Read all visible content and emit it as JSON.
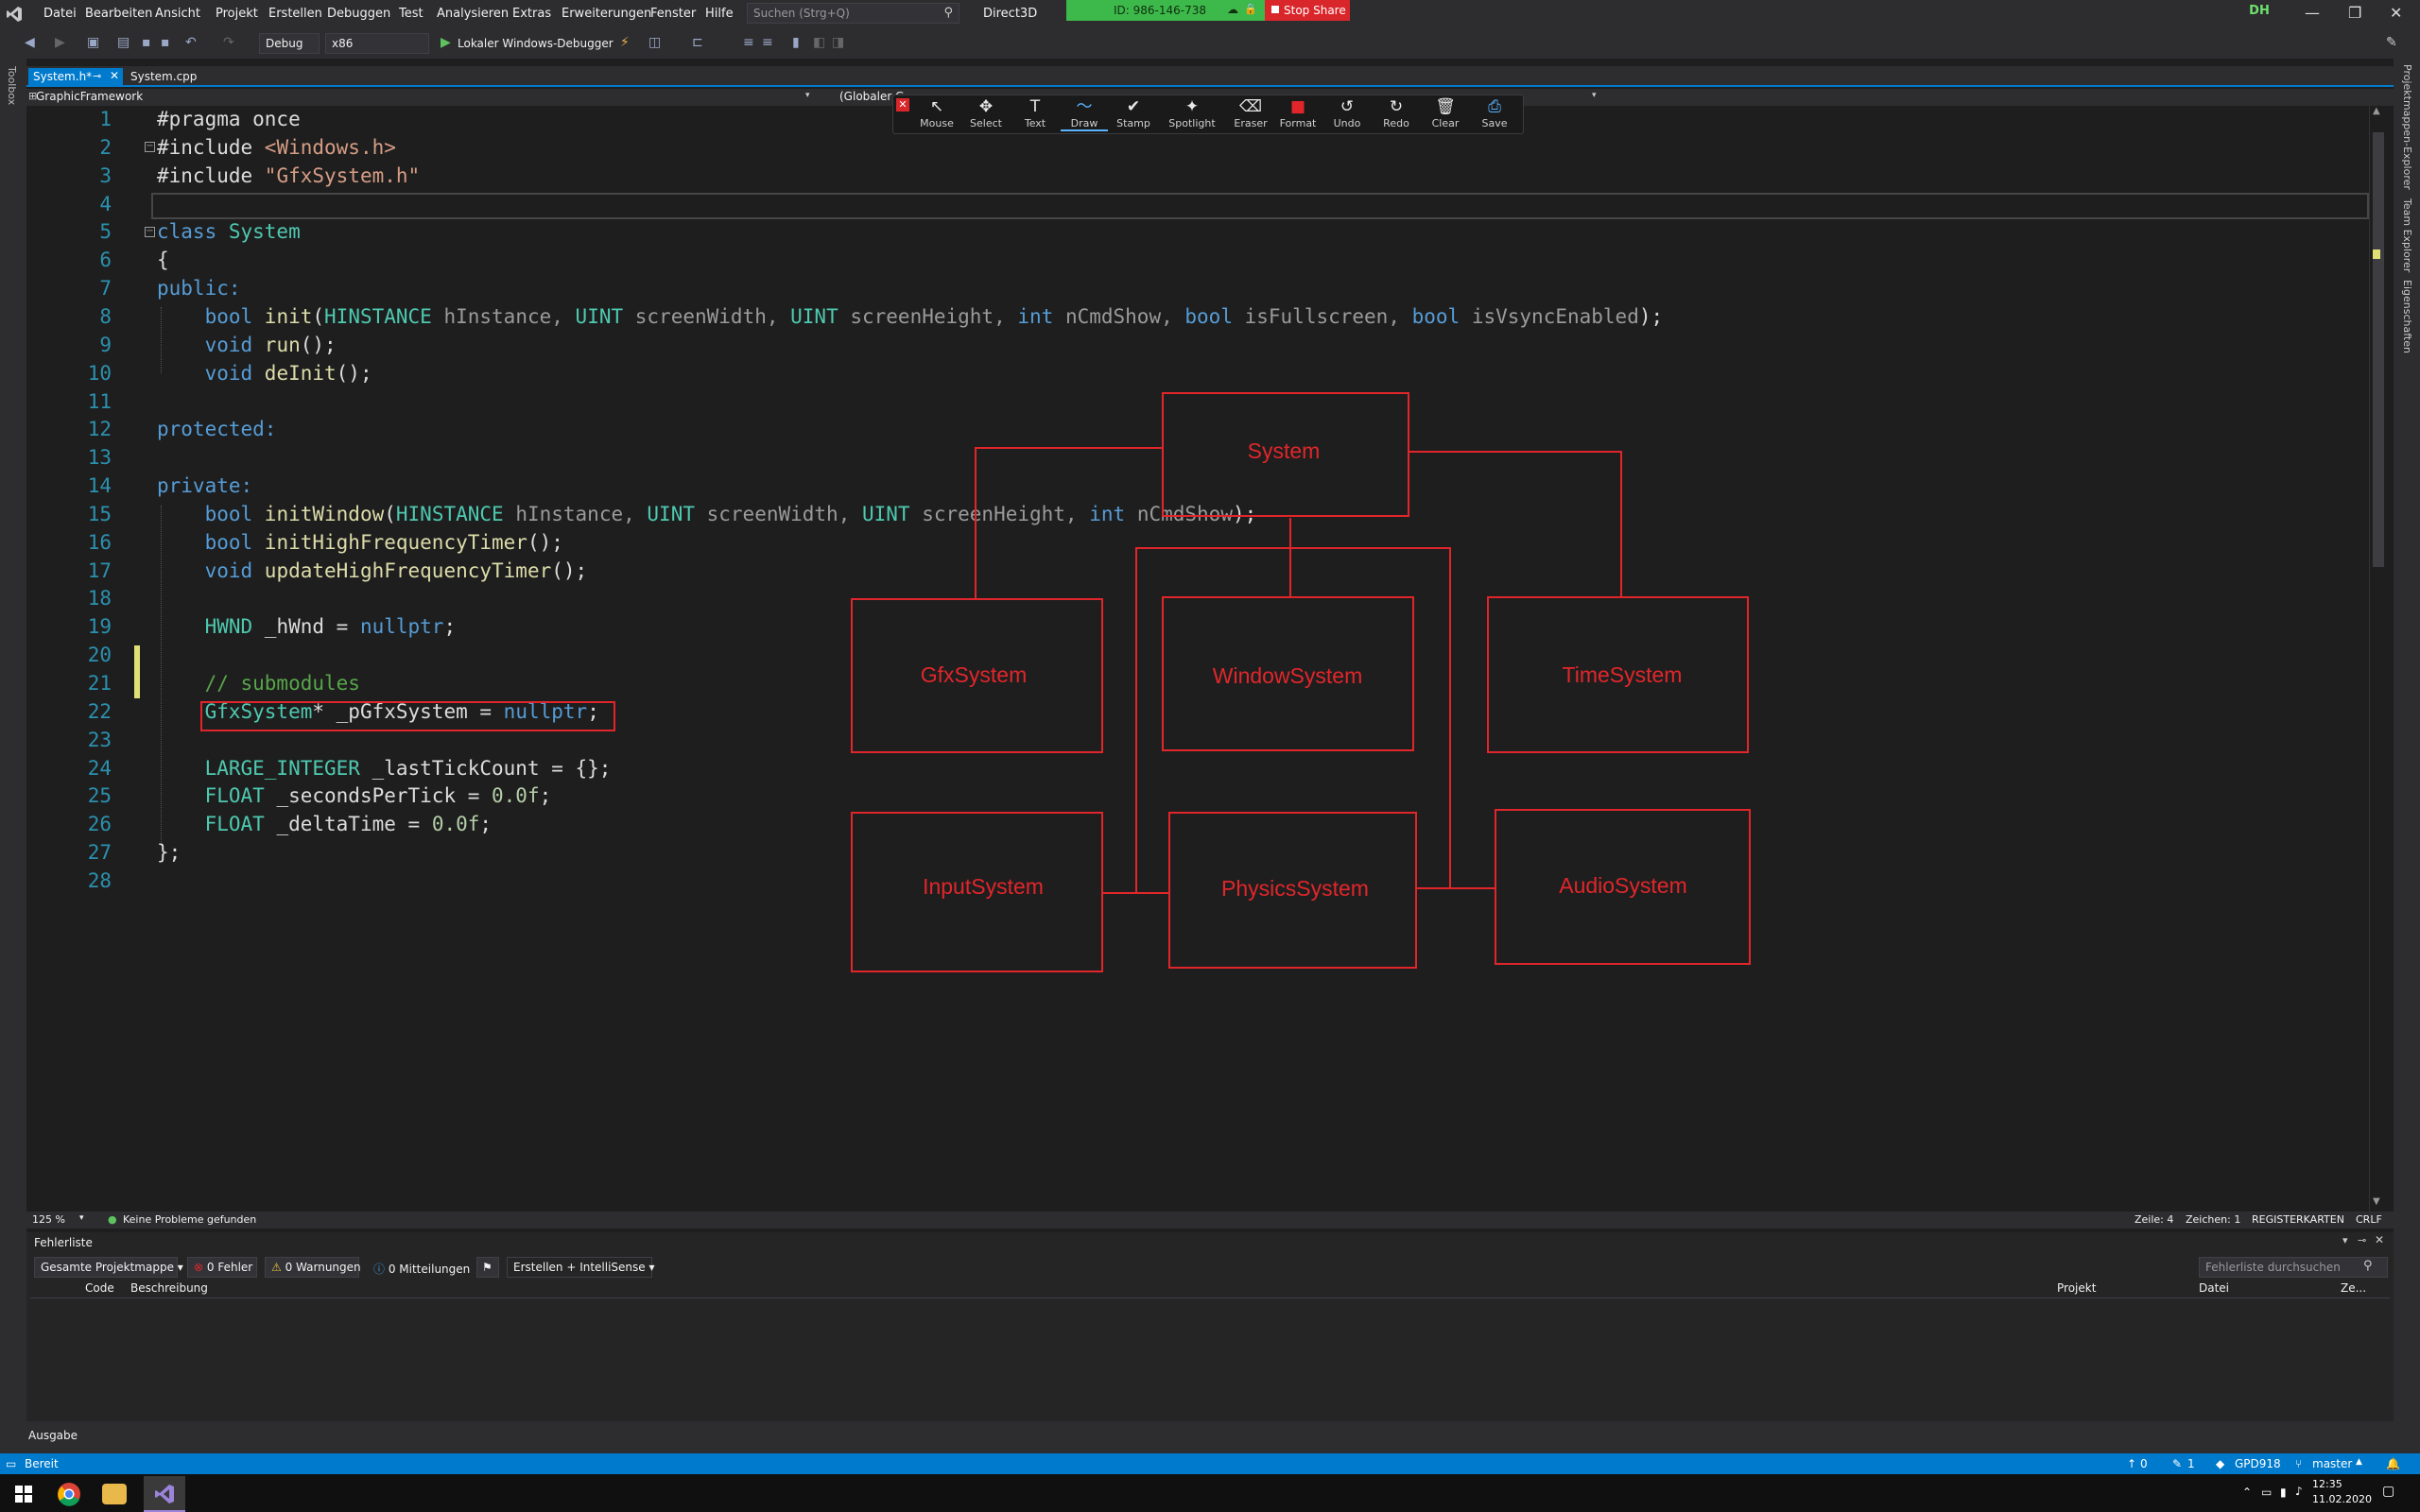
{
  "menu": [
    "Datei",
    "Bearbeiten",
    "Ansicht",
    "Projekt",
    "Erstellen",
    "Debuggen",
    "Test",
    "Analysieren",
    "Extras",
    "Erweiterungen",
    "Fenster",
    "Hilfe"
  ],
  "search_placeholder": "Suchen (Strg+Q)",
  "solution_name": "Direct3D",
  "share": {
    "id_label": "ID: 986-146-738",
    "stop_label": "Stop Share",
    "accent": "#3db84a",
    "stop_color": "#d9262b"
  },
  "user_initials": "DH",
  "toolbar": {
    "config": "Debug",
    "platform": "x86",
    "debugger": "Lokaler Windows-Debugger"
  },
  "left_strip_label": "Toolbox",
  "right_strip_labels": [
    "Projektmappen-Explorer",
    "Team Explorer",
    "Eigenschaften"
  ],
  "tabs": {
    "active": "System.h*",
    "inactive": "System.cpp"
  },
  "nav": {
    "project": "GraphicFramework",
    "scope": "(Globaler G"
  },
  "annotation_tools": [
    {
      "label": "Mouse",
      "icon": "cursor-icon",
      "glyph": "↖"
    },
    {
      "label": "Select",
      "icon": "move-icon",
      "glyph": "✥"
    },
    {
      "label": "Text",
      "icon": "text-icon",
      "glyph": "T"
    },
    {
      "label": "Draw",
      "icon": "draw-icon",
      "glyph": "〜"
    },
    {
      "label": "Stamp",
      "icon": "check-icon",
      "glyph": "✔"
    },
    {
      "label": "Spotlight",
      "icon": "spotlight-icon",
      "glyph": "✦"
    },
    {
      "label": "Eraser",
      "icon": "eraser-icon",
      "glyph": "⌫"
    },
    {
      "label": "Format",
      "icon": "format-icon",
      "glyph": "■"
    },
    {
      "label": "Undo",
      "icon": "undo-icon",
      "glyph": "↺"
    },
    {
      "label": "Redo",
      "icon": "redo-icon",
      "glyph": "↻"
    },
    {
      "label": "Clear",
      "icon": "trash-icon",
      "glyph": "🗑"
    },
    {
      "label": "Save",
      "icon": "save-icon",
      "glyph": "⎙"
    }
  ],
  "code_lines": [
    [
      {
        "t": "#pragma once",
        "c": "#dcdcdc"
      }
    ],
    [
      {
        "t": "#include ",
        "c": "#dcdcdc"
      },
      {
        "t": "<Windows.h>",
        "c": "#d69d85"
      }
    ],
    [
      {
        "t": "#include ",
        "c": "#dcdcdc"
      },
      {
        "t": "\"GfxSystem.h\"",
        "c": "#d69d85"
      }
    ],
    [],
    [
      {
        "t": "class ",
        "c": "#569cd6"
      },
      {
        "t": "System",
        "c": "#4ec9b0"
      }
    ],
    [
      {
        "t": "{",
        "c": "#dcdcdc"
      }
    ],
    [
      {
        "t": "public:",
        "c": "#569cd6"
      }
    ],
    [
      {
        "t": "    bool ",
        "c": "#569cd6"
      },
      {
        "t": "init",
        "c": "#dcdcaa"
      },
      {
        "t": "(",
        "c": "#dcdcdc"
      },
      {
        "t": "HINSTANCE ",
        "c": "#4ec9b0"
      },
      {
        "t": "hInstance, ",
        "c": "#9a9a9a"
      },
      {
        "t": "UINT ",
        "c": "#4ec9b0"
      },
      {
        "t": "screenWidth, ",
        "c": "#9a9a9a"
      },
      {
        "t": "UINT ",
        "c": "#4ec9b0"
      },
      {
        "t": "screenHeight, ",
        "c": "#9a9a9a"
      },
      {
        "t": "int ",
        "c": "#569cd6"
      },
      {
        "t": "nCmdShow, ",
        "c": "#9a9a9a"
      },
      {
        "t": "bool ",
        "c": "#569cd6"
      },
      {
        "t": "isFullscreen, ",
        "c": "#9a9a9a"
      },
      {
        "t": "bool ",
        "c": "#569cd6"
      },
      {
        "t": "isVsyncEnabled",
        "c": "#9a9a9a"
      },
      {
        "t": ");",
        "c": "#dcdcdc"
      }
    ],
    [
      {
        "t": "    void ",
        "c": "#569cd6"
      },
      {
        "t": "run",
        "c": "#dcdcaa"
      },
      {
        "t": "();",
        "c": "#dcdcdc"
      }
    ],
    [
      {
        "t": "    void ",
        "c": "#569cd6"
      },
      {
        "t": "deInit",
        "c": "#dcdcaa"
      },
      {
        "t": "();",
        "c": "#dcdcdc"
      }
    ],
    [],
    [
      {
        "t": "protected:",
        "c": "#569cd6"
      }
    ],
    [],
    [
      {
        "t": "private:",
        "c": "#569cd6"
      }
    ],
    [
      {
        "t": "    bool ",
        "c": "#569cd6"
      },
      {
        "t": "initWindow",
        "c": "#dcdcaa"
      },
      {
        "t": "(",
        "c": "#dcdcdc"
      },
      {
        "t": "HINSTANCE ",
        "c": "#4ec9b0"
      },
      {
        "t": "hInstance, ",
        "c": "#9a9a9a"
      },
      {
        "t": "UINT ",
        "c": "#4ec9b0"
      },
      {
        "t": "screenWidth, ",
        "c": "#9a9a9a"
      },
      {
        "t": "UINT ",
        "c": "#4ec9b0"
      },
      {
        "t": "screenHeight, ",
        "c": "#9a9a9a"
      },
      {
        "t": "int ",
        "c": "#569cd6"
      },
      {
        "t": "nCmdShow",
        "c": "#9a9a9a"
      },
      {
        "t": ");",
        "c": "#dcdcdc"
      }
    ],
    [
      {
        "t": "    bool ",
        "c": "#569cd6"
      },
      {
        "t": "initHighFrequencyTimer",
        "c": "#dcdcaa"
      },
      {
        "t": "();",
        "c": "#dcdcdc"
      }
    ],
    [
      {
        "t": "    void ",
        "c": "#569cd6"
      },
      {
        "t": "updateHighFrequencyTimer",
        "c": "#dcdcaa"
      },
      {
        "t": "();",
        "c": "#dcdcdc"
      }
    ],
    [],
    [
      {
        "t": "    HWND ",
        "c": "#4ec9b0"
      },
      {
        "t": "_hWnd = ",
        "c": "#dcdcdc"
      },
      {
        "t": "nullptr",
        "c": "#569cd6"
      },
      {
        "t": ";",
        "c": "#dcdcdc"
      }
    ],
    [],
    [
      {
        "t": "    // submodules",
        "c": "#57a64a"
      }
    ],
    [
      {
        "t": "    GfxSystem",
        "c": "#4ec9b0"
      },
      {
        "t": "* _pGfxSystem = ",
        "c": "#dcdcdc"
      },
      {
        "t": "nullptr",
        "c": "#569cd6"
      },
      {
        "t": ";",
        "c": "#dcdcdc"
      }
    ],
    [],
    [
      {
        "t": "    LARGE_INTEGER ",
        "c": "#4ec9b0"
      },
      {
        "t": "_lastTickCount = {};",
        "c": "#dcdcdc"
      }
    ],
    [
      {
        "t": "    FLOAT ",
        "c": "#4ec9b0"
      },
      {
        "t": "_secondsPerTick = ",
        "c": "#dcdcdc"
      },
      {
        "t": "0.0f",
        "c": "#b5cea8"
      },
      {
        "t": ";",
        "c": "#dcdcdc"
      }
    ],
    [
      {
        "t": "    FLOAT ",
        "c": "#4ec9b0"
      },
      {
        "t": "_deltaTime = ",
        "c": "#dcdcdc"
      },
      {
        "t": "0.0f",
        "c": "#b5cea8"
      },
      {
        "t": ";",
        "c": "#dcdcdc"
      }
    ],
    [
      {
        "t": "};",
        "c": "#dcdcdc"
      }
    ],
    []
  ],
  "diagram": {
    "color": "#e1262b",
    "nodes": [
      "System",
      "GfxSystem",
      "WindowSystem",
      "TimeSystem",
      "InputSystem",
      "PhysicsSystem",
      "AudioSystem"
    ]
  },
  "editor_status": {
    "zoom": "125 %",
    "issues": "Keine Probleme gefunden",
    "line": "Zeile: 4",
    "char": "Zeichen: 1",
    "mode": "REGISTERKARTEN",
    "eol": "CRLF"
  },
  "errorlist": {
    "title": "Fehlerliste",
    "scope": "Gesamte Projektmappe",
    "errors": "0 Fehler",
    "warnings": "0 Warnungen",
    "messages": "0 Mitteilungen",
    "build_filter": "Erstellen + IntelliSense",
    "search_placeholder": "Fehlerliste durchsuchen",
    "columns": [
      "Code",
      "Beschreibung",
      "Projekt",
      "Datei",
      "Ze..."
    ]
  },
  "output_tab": "Ausgabe",
  "status": {
    "ready": "Bereit",
    "up": "0",
    "pencil": "1",
    "repo": "GPD918",
    "branch": "master"
  },
  "taskbar": {
    "time": "12:35",
    "date": "11.02.2020"
  }
}
